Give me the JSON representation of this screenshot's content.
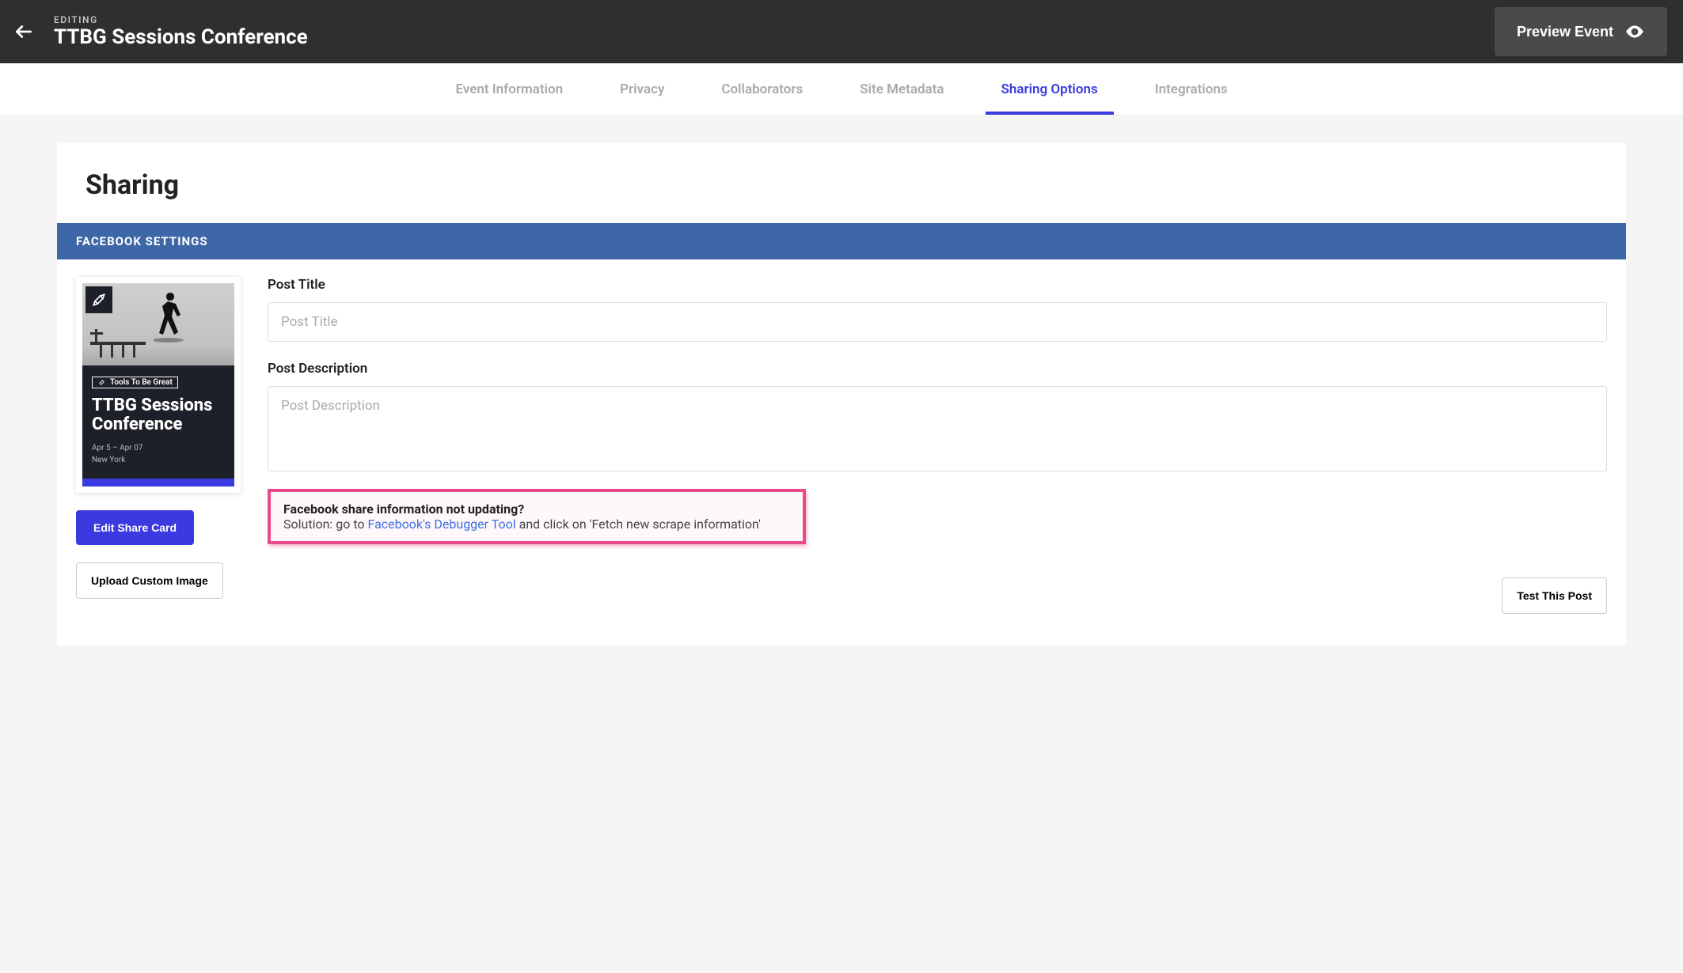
{
  "header": {
    "kicker": "EDITING",
    "title": "TTBG Sessions Conference",
    "preview_label": "Preview Event"
  },
  "tabs": [
    {
      "label": "Event Information",
      "active": false
    },
    {
      "label": "Privacy",
      "active": false
    },
    {
      "label": "Collaborators",
      "active": false
    },
    {
      "label": "Site Metadata",
      "active": false
    },
    {
      "label": "Sharing Options",
      "active": true
    },
    {
      "label": "Integrations",
      "active": false
    }
  ],
  "page": {
    "title": "Sharing"
  },
  "section": {
    "facebook_header": "FACEBOOK SETTINGS"
  },
  "card": {
    "brand_label": "Tools To Be Great",
    "title": "TTBG Sessions Conference",
    "date_range": "Apr 5 – Apr 07",
    "location": "New York"
  },
  "buttons": {
    "edit_share_card": "Edit Share Card",
    "upload_custom_image": "Upload Custom Image",
    "test_this_post": "Test This Post"
  },
  "form": {
    "post_title_label": "Post Title",
    "post_title_placeholder": "Post Title",
    "post_title_value": "",
    "post_desc_label": "Post Description",
    "post_desc_placeholder": "Post Description",
    "post_desc_value": ""
  },
  "callout": {
    "title": "Facebook share information not updating?",
    "text_prefix": "Solution: go to ",
    "link_text": "Facebook's Debugger Tool",
    "text_suffix": " and click on 'Fetch new scrape information'"
  }
}
